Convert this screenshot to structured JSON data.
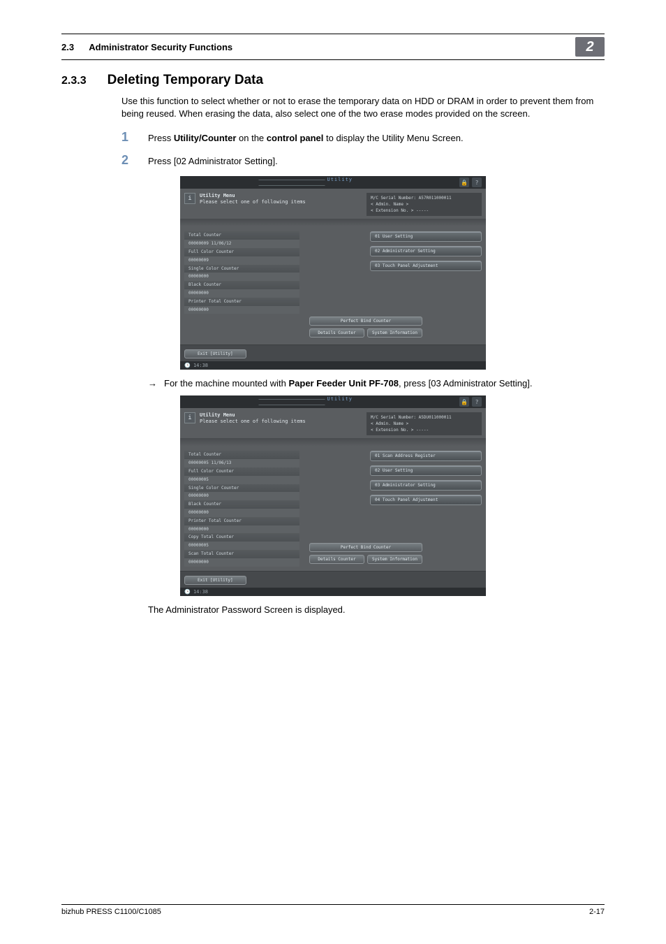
{
  "header": {
    "section_number": "2.3",
    "section_title": "Administrator Security Functions",
    "chapter": "2"
  },
  "heading": {
    "number": "2.3.3",
    "title": "Deleting Temporary Data"
  },
  "intro": "Use this function to select whether or not to erase the temporary data on HDD or DRAM in order to prevent them from being reused. When erasing the data, also select one of the two erase modes provided on the screen.",
  "steps": {
    "s1": {
      "num": "1",
      "prefix": "Press ",
      "bold1": "Utility/Counter",
      "mid": " on the ",
      "bold2": "control panel",
      "suffix": " to display the Utility Menu Screen."
    },
    "s2": {
      "num": "2",
      "text": "Press [02 Administrator Setting]."
    }
  },
  "arrow_line": {
    "arrow": "→",
    "prefix": "For the machine mounted with ",
    "bold": "Paper Feeder Unit PF-708",
    "suffix": ", press [03 Administrator Setting]."
  },
  "follow_text": "The Administrator Password Screen is displayed.",
  "screenshot1": {
    "tab": "Utility",
    "title1": "Utility Menu",
    "title2": "Please select one of following items",
    "serial": "M/C Serial Number: A57R011000011",
    "admin": "< Admin. Name >",
    "ext": "< Extension No. >  -----",
    "counters": [
      {
        "label": "Total Counter",
        "value": "00000009   11/06/12"
      },
      {
        "label": "Full Color Counter",
        "value": "00000009"
      },
      {
        "label": "Single Color Counter",
        "value": "00000000"
      },
      {
        "label": "Black Counter",
        "value": "00000000"
      },
      {
        "label": "Printer Total Counter",
        "value": "00000000"
      }
    ],
    "menu": [
      "01 User Setting",
      "02 Administrator Setting",
      "03 Touch Panel Adjustment"
    ],
    "btns": {
      "perfect": "Perfect Bind Counter",
      "details": "Details Counter",
      "sysinfo": "System Information",
      "exit": "Exit [Utility]",
      "time": "14:38"
    }
  },
  "screenshot2": {
    "tab": "Utility",
    "title1": "Utility Menu",
    "title2": "Please select one of following items",
    "serial": "M/C Serial Number: A5DU011000011",
    "admin": "< Admin. Name >",
    "ext": "< Extension No. >  -----",
    "counters": [
      {
        "label": "Total Counter",
        "value": "00000005   11/06/13"
      },
      {
        "label": "Full Color Counter",
        "value": "00000005"
      },
      {
        "label": "Single Color Counter",
        "value": "00000000"
      },
      {
        "label": "Black Counter",
        "value": "00000000"
      },
      {
        "label": "Printer Total Counter",
        "value": "00000000"
      },
      {
        "label": "Copy Total Counter",
        "value": "00000005"
      },
      {
        "label": "Scan Total Counter",
        "value": "00000000"
      }
    ],
    "menu": [
      "01 Scan Address Register",
      "02 User Setting",
      "03 Administrator Setting",
      "04 Touch Panel Adjustment"
    ],
    "btns": {
      "perfect": "Perfect Bind Counter",
      "details": "Details Counter",
      "sysinfo": "System Information",
      "exit": "Exit [Utility]",
      "time": "14:38"
    }
  },
  "footer": {
    "product": "bizhub PRESS C1100/C1085",
    "page": "2-17"
  }
}
